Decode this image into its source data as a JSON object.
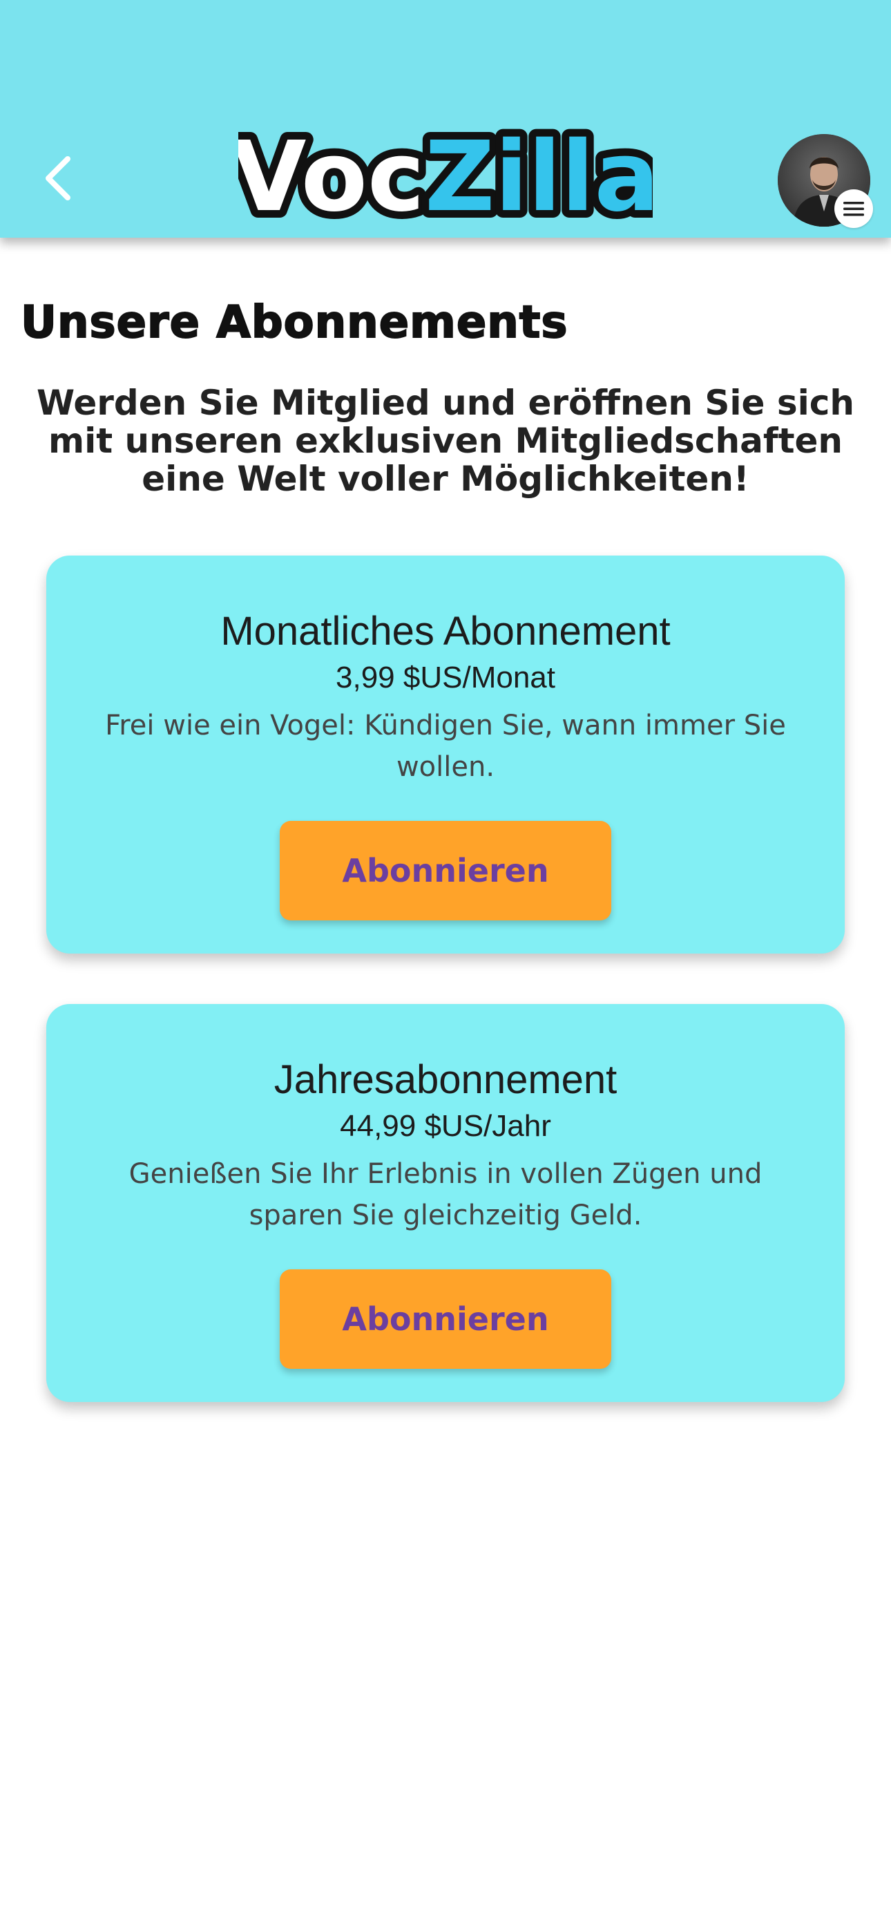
{
  "colors": {
    "header_bg": "#7be3ee",
    "card_bg": "#82eff4",
    "button_bg": "#ffa329",
    "button_text": "#6b3fa0",
    "logo_black": "#111111",
    "logo_blue": "#35c4ec"
  },
  "header": {
    "back_icon": "chevron-left-icon",
    "logo": {
      "part1": "Voc",
      "part2": "Zilla"
    },
    "avatar_icon": "avatar",
    "menu_icon": "menu-icon"
  },
  "main": {
    "title": "Unsere Abonnements",
    "intro": "Werden Sie Mitglied und eröffnen Sie sich mit unseren exklusiven Mitgliedschaften eine Welt voller Möglichkeiten!",
    "plans": [
      {
        "name": "Monatliches Abonnement",
        "price": "3,99 $US/Monat",
        "description": "Frei wie ein Vogel: Kündigen Sie, wann immer Sie wollen.",
        "button_label": "Abonnieren"
      },
      {
        "name": "Jahresabonnement",
        "price": "44,99 $US/Jahr",
        "description": "Genießen Sie Ihr Erlebnis in vollen Zügen und sparen Sie gleichzeitig Geld.",
        "button_label": "Abonnieren"
      }
    ]
  }
}
